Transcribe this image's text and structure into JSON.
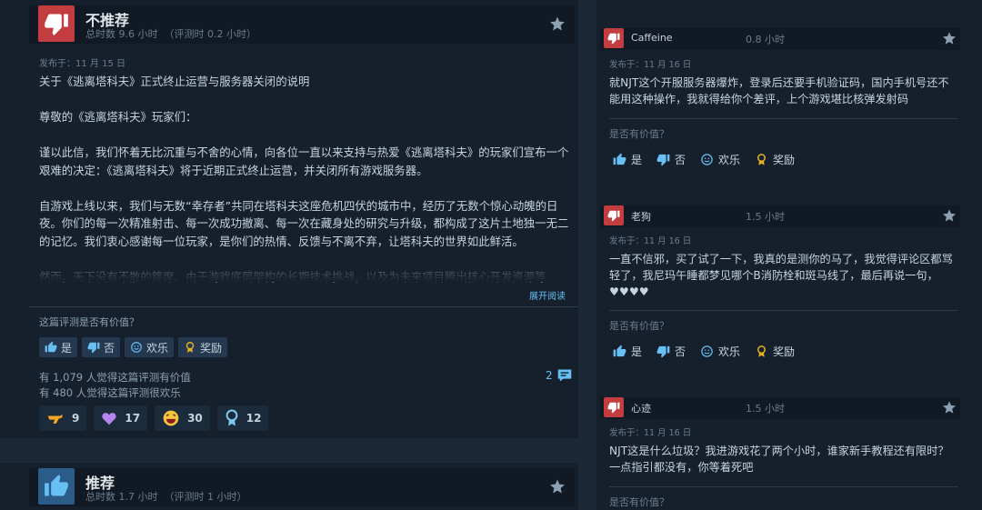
{
  "main_review": {
    "verdict": "不推荐",
    "hours": "总时数 9.6 小时",
    "hours_at_review": "（评测时 0.2 小时）",
    "posted": "发布于：11 月 15 日",
    "paragraphs": [
      "关于《逃离塔科夫》正式终止运营与服务器关闭的说明",
      "尊敬的《逃离塔科夫》玩家们：",
      "谨以此信，我们怀着无比沉重与不舍的心情，向各位一直以来支持与热爱《逃离塔科夫》的玩家们宣布一个艰难的决定：《逃离塔科夫》将于近期正式终止运营，并关闭所有游戏服务器。",
      "自游戏上线以来，我们与无数“幸存者”共同在塔科夫这座危机四伏的城市中，经历了无数个惊心动魄的日夜。你们的每一次精准射击、每一次成功撤离、每一次在藏身处的研究与升级，都构成了这片土地独一无二的记忆。我们衷心感谢每一位玩家，是你们的热情、反馈与不离不弃，让塔科夫的世界如此鲜活。",
      "然而，天下没有不散的筵席。由于游戏底层架构的长期技术挑战，以及为未来项目腾出核心开发资源等"
    ],
    "read_more": "展开阅读",
    "helpful_question": "这篇评测是否有价值？",
    "vote_yes": "是",
    "vote_no": "否",
    "vote_funny": "欢乐",
    "vote_award": "奖励",
    "helpful_count": "有 1,079 人觉得这篇评测有价值",
    "funny_count": "有 480 人觉得这篇评测很欢乐",
    "comment_count": "2",
    "awards": [
      {
        "icon": "gun-icon",
        "count": "9"
      },
      {
        "icon": "heart-icon",
        "count": "17"
      },
      {
        "icon": "laugh-face-icon",
        "count": "30"
      },
      {
        "icon": "medal-icon",
        "count": "12"
      }
    ],
    "colors": {
      "negative": "#c33c40",
      "positive": "#2b5c87",
      "link": "#66c0f4"
    }
  },
  "second_review": {
    "verdict": "推荐",
    "hours": "总时数 1.7 小时",
    "hours_at_review": "（评测时 1 小时）"
  },
  "side_reviews": [
    {
      "name": "Caffeine",
      "hours": "0.8 小时",
      "posted": "发布于：11 月 16 日",
      "text": "就NJT这个开服服务器爆炸，登录后还要手机验证码，国内手机号还不能用这种操作，我就得给你个差评，上个游戏堪比核弹发射码",
      "helpful_question": "是否有价值？",
      "vote_yes": "是",
      "vote_no": "否",
      "vote_funny": "欢乐",
      "vote_award": "奖励"
    },
    {
      "name": "老狗",
      "hours": "1.5 小时",
      "posted": "发布于：11 月 16 日",
      "text": "一直不信邪，买了试了一下，我真的是测你的马了，我觉得评论区都骂轻了，我尼玛午睡都梦见哪个B消防栓和斑马线了，最后再说一句，♥♥♥♥",
      "helpful_question": "是否有价值？",
      "vote_yes": "是",
      "vote_no": "否",
      "vote_funny": "欢乐",
      "vote_award": "奖励"
    },
    {
      "name": "心迹",
      "hours": "1.5 小时",
      "posted": "发布于：11 月 16 日",
      "text": "NJT这是什么垃圾？我进游戏花了两个小时，谁家新手教程还有限时？一点指引都没有，你等着死吧",
      "helpful_question": "是否有价值？"
    }
  ]
}
